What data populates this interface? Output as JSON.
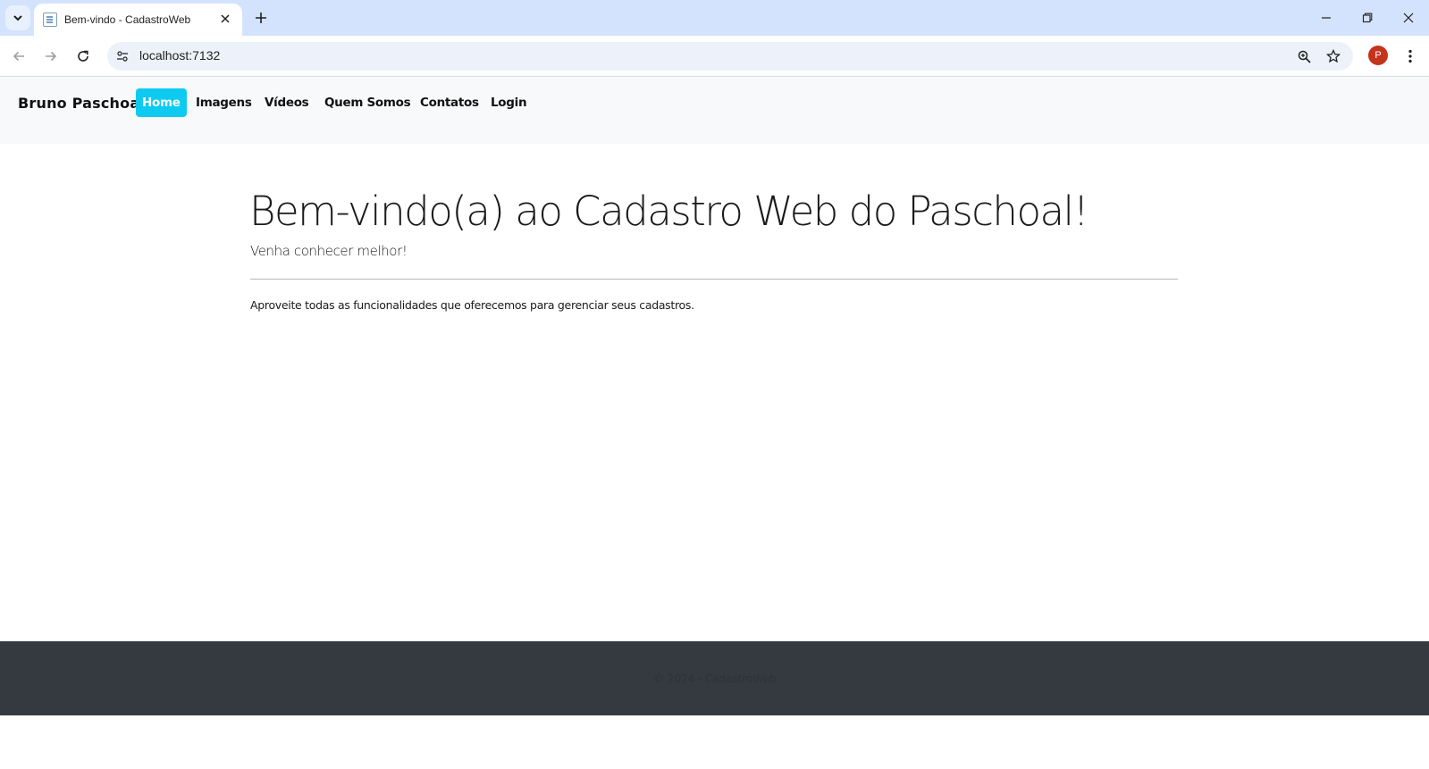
{
  "browser": {
    "tab_title": "Bem-vindo - CadastroWeb",
    "url": "localhost:7132",
    "avatar_letter": "P",
    "icons": {
      "tab_list": "chevron-down-icon",
      "favicon": "document-icon",
      "close": "close-icon",
      "new_tab": "plus-icon",
      "back": "back-arrow-icon",
      "forward": "forward-arrow-icon",
      "reload": "reload-icon",
      "site_info": "tune-icon",
      "zoom": "zoom-icon",
      "bookmark": "star-icon",
      "menu": "kebab-menu-icon"
    }
  },
  "navbar": {
    "brand": "Bruno Paschoal",
    "links": [
      {
        "label": "Home",
        "active": true
      },
      {
        "label": "Imagens",
        "active": false
      },
      {
        "label": "Vídeos",
        "active": false
      },
      {
        "label": "Quem Somos",
        "active": false
      },
      {
        "label": "Contatos",
        "active": false
      },
      {
        "label": "Login",
        "active": false
      }
    ],
    "active_color": "#0dcaf0"
  },
  "main": {
    "title": "Bem-vindo(a) ao Cadastro Web do Paschoal!",
    "lead": "Venha conhecer melhor!",
    "text": "Aproveite todas as funcionalidades que oferecemos para gerenciar seus cadastros."
  },
  "footer": {
    "text": "© 2024 - CadastroWeb",
    "background": "#343a40"
  }
}
